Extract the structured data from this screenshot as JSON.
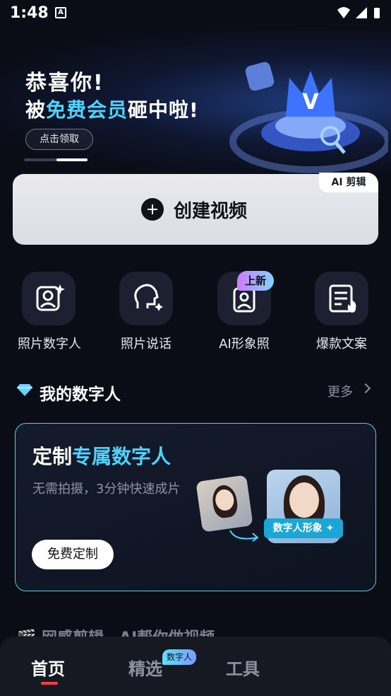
{
  "status_bar": {
    "time": "1:48",
    "notif_icon": "A"
  },
  "banner": {
    "title_line1": "恭喜你!",
    "title_line2_prefix": "被",
    "title_line2_highlight": "免费会员",
    "title_line2_suffix": "砸中啦!",
    "button_label": "点击领取"
  },
  "create": {
    "tag": "AI 剪辑",
    "label": "创建视频"
  },
  "tools": [
    {
      "label": "照片数字人",
      "icon": "portrait-sparkle-icon"
    },
    {
      "label": "照片说话",
      "icon": "talking-head-icon"
    },
    {
      "label": "AI形象照",
      "icon": "photo-id-icon",
      "badge": "上新"
    },
    {
      "label": "爆款文案",
      "icon": "document-fire-icon"
    }
  ],
  "my_digital": {
    "title": "我的数字人",
    "more": "更多"
  },
  "custom_card": {
    "title_prefix": "定制",
    "title_highlight": "专属数字人",
    "subtitle": "无需拍摄，3分钟快速成片",
    "button": "免费定制",
    "image_tag": "数字人形象 ✦"
  },
  "peek_section": {
    "title": "🎬 网感剪辑，AI帮你做视频"
  },
  "bottom_nav": {
    "items": [
      {
        "label": "首页",
        "active": true
      },
      {
        "label": "精选",
        "badge": "数字人"
      },
      {
        "label": "工具"
      }
    ]
  },
  "colors": {
    "accent": "#4fd3ff",
    "active_indicator": "#ff3b4a",
    "card_border": "#4fd0e0"
  }
}
